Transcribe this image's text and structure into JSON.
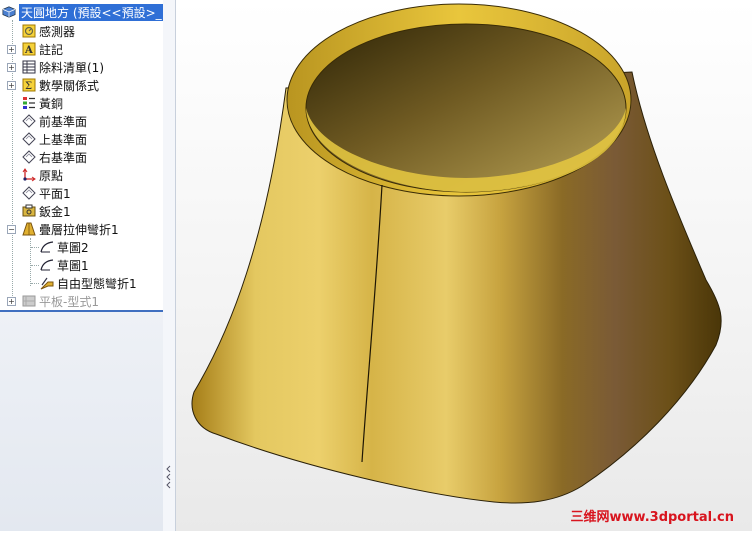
{
  "feature_tree": {
    "root": {
      "label": "天圓地方 (預設<<預設>_",
      "icon": "part-icon"
    },
    "items": [
      {
        "label": "感測器",
        "icon": "sensor-icon",
        "expander": false
      },
      {
        "label": "註記",
        "icon": "annotation-icon",
        "expander": true
      },
      {
        "label": "除料清單(1)",
        "icon": "cut-list-icon",
        "expander": true
      },
      {
        "label": "數學關係式",
        "icon": "equation-icon",
        "expander": true
      },
      {
        "label": "黃銅",
        "icon": "material-icon",
        "expander": false
      },
      {
        "label": "前基準面",
        "icon": "plane-icon",
        "expander": false
      },
      {
        "label": "上基準面",
        "icon": "plane-icon",
        "expander": false
      },
      {
        "label": "右基準面",
        "icon": "plane-icon",
        "expander": false
      },
      {
        "label": "原點",
        "icon": "origin-icon",
        "expander": false
      },
      {
        "label": "平面1",
        "icon": "plane-icon",
        "expander": false
      },
      {
        "label": "鈑金1",
        "icon": "sheet-metal-icon",
        "expander": false
      },
      {
        "label": "疊層拉伸彎折1",
        "icon": "lofted-bend-icon",
        "expander": true,
        "expanded": true,
        "children": [
          {
            "label": "草圖2",
            "icon": "sketch-icon"
          },
          {
            "label": "草圖1",
            "icon": "sketch-icon"
          },
          {
            "label": "自由型態彎折1",
            "icon": "sketched-bend-icon"
          }
        ]
      },
      {
        "label": "平板-型式1",
        "icon": "flat-pattern-icon",
        "expander": true,
        "disabled": true
      }
    ]
  },
  "watermark": "三维网www.3dportal.cn",
  "colors": {
    "selection": "#2f6fd6",
    "brass_light": "#e2c866",
    "brass_dark": "#5a4210",
    "watermark": "#d8141e"
  }
}
